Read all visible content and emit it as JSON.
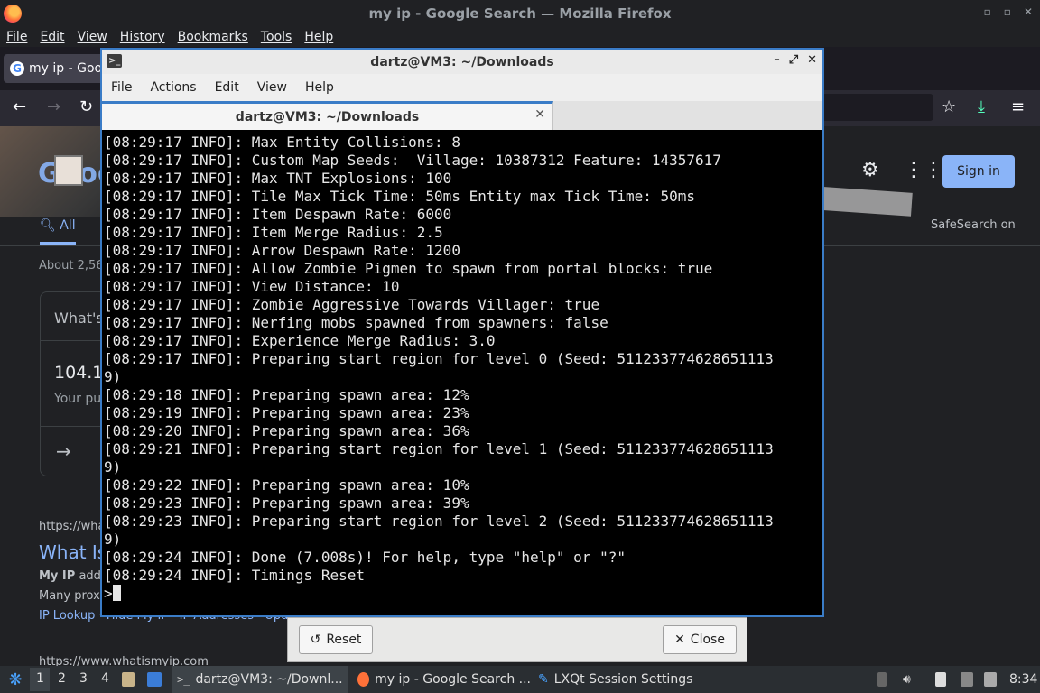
{
  "firefox": {
    "window_title": "my ip - Google Search — Mozilla Firefox",
    "menu": [
      "File",
      "Edit",
      "View",
      "History",
      "Bookmarks",
      "Tools",
      "Help"
    ],
    "tab_title": "my ip - Goo"
  },
  "google": {
    "sign_in_label": "Sign in",
    "safesearch_label": "SafeSearch on",
    "tab_all_label": "All",
    "about_text": "About 2,56",
    "card_question": "What's",
    "ip_value": "104.1",
    "ip_caption": "Your pu",
    "result_url_1": "https://wha",
    "result_title": "What Is",
    "result_snippet_bold": "My IP",
    "result_snippet_1": " addr",
    "result_snippet_2": "Many prox",
    "result_links": "IP Lookup · Hide My IP · IP Addresses · Upd",
    "result_url_2": "https://www.whatismyip.com"
  },
  "terminal": {
    "window_title": "dartz@VM3: ~/Downloads",
    "menu": [
      "File",
      "Actions",
      "Edit",
      "View",
      "Help"
    ],
    "tab_title": "dartz@VM3: ~/Downloads",
    "lines": [
      "[08:29:17 INFO]: Max Entity Collisions: 8",
      "[08:29:17 INFO]: Custom Map Seeds:  Village: 10387312 Feature: 14357617",
      "[08:29:17 INFO]: Max TNT Explosions: 100",
      "[08:29:17 INFO]: Tile Max Tick Time: 50ms Entity max Tick Time: 50ms",
      "[08:29:17 INFO]: Item Despawn Rate: 6000",
      "[08:29:17 INFO]: Item Merge Radius: 2.5",
      "[08:29:17 INFO]: Arrow Despawn Rate: 1200",
      "[08:29:17 INFO]: Allow Zombie Pigmen to spawn from portal blocks: true",
      "[08:29:17 INFO]: View Distance: 10",
      "[08:29:17 INFO]: Zombie Aggressive Towards Villager: true",
      "[08:29:17 INFO]: Nerfing mobs spawned from spawners: false",
      "[08:29:17 INFO]: Experience Merge Radius: 3.0",
      "[08:29:17 INFO]: Preparing start region for level 0 (Seed: 511233774628651113",
      "9)",
      "[08:29:18 INFO]: Preparing spawn area: 12%",
      "[08:29:19 INFO]: Preparing spawn area: 23%",
      "[08:29:20 INFO]: Preparing spawn area: 36%",
      "[08:29:21 INFO]: Preparing start region for level 1 (Seed: 511233774628651113",
      "9)",
      "[08:29:22 INFO]: Preparing spawn area: 10%",
      "[08:29:23 INFO]: Preparing spawn area: 39%",
      "[08:29:23 INFO]: Preparing start region for level 2 (Seed: 511233774628651113",
      "9)",
      "[08:29:24 INFO]: Done (7.008s)! For help, type \"help\" or \"?\"",
      "[08:29:24 INFO]: Timings Reset"
    ],
    "prompt": ">"
  },
  "dialog": {
    "reset_label": "Reset",
    "close_label": "Close"
  },
  "taskbar": {
    "desktops": [
      "1",
      "2",
      "3",
      "4"
    ],
    "tasks": [
      "dartz@VM3: ~/Downl...",
      "my ip - Google Search ...",
      "LXQt Session Settings"
    ],
    "clock": "8:34"
  },
  "colors": {
    "terminal_bg": "#000000",
    "terminal_fg": "#e6e6e6",
    "focus_border": "#3a7cc7",
    "google_link": "#8ab4f8"
  }
}
